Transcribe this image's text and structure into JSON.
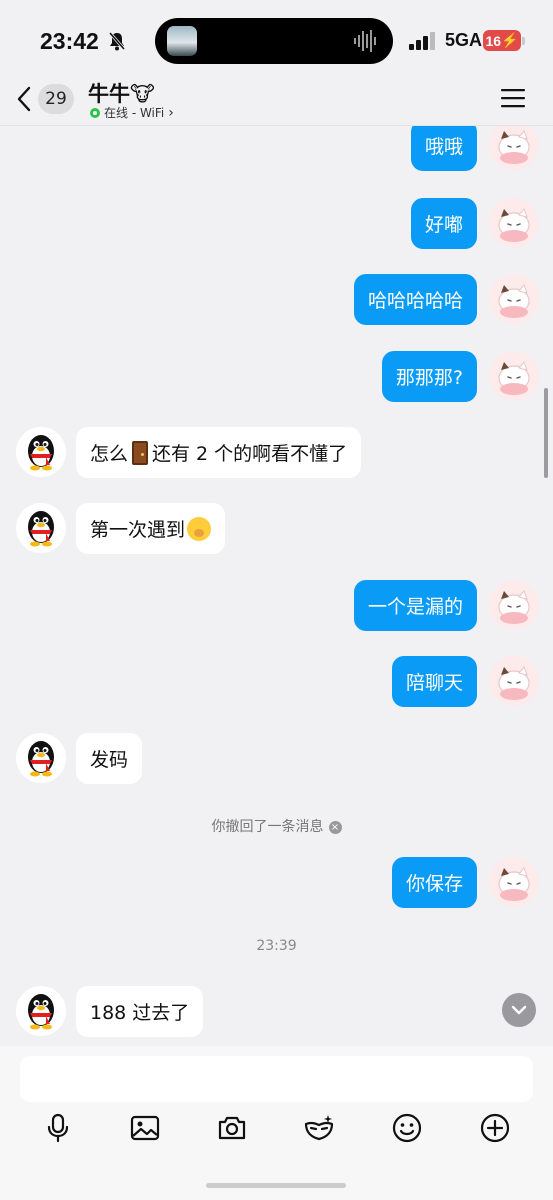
{
  "status_bar": {
    "time": "23:42",
    "network": "5GA",
    "battery": "16"
  },
  "header": {
    "back_count": "29",
    "contact_name": "牛牛🐮",
    "status_text": "在线 - WiFi",
    "status_chevron": "›"
  },
  "messages": [
    {
      "side": "out",
      "text": "哦哦"
    },
    {
      "side": "out",
      "text": "好嘟"
    },
    {
      "side": "out",
      "text": "哈哈哈哈哈"
    },
    {
      "side": "out",
      "text": "那那那?"
    },
    {
      "side": "in",
      "text_before": "怎么",
      "icon": "door-emoji",
      "text_after": "还有 2 个的啊看不懂了"
    },
    {
      "side": "in",
      "text": "第一次遇到",
      "icon": "yawning-face-emoji"
    },
    {
      "side": "out",
      "text": "一个是漏的"
    },
    {
      "side": "out",
      "text": "陪聊天"
    },
    {
      "side": "in",
      "text": "发码"
    },
    {
      "side": "out",
      "text": "你保存"
    },
    {
      "side": "in",
      "text": "188 过去了"
    }
  ],
  "system": {
    "recall_notice": "你撤回了一条消息",
    "recall_close": "×",
    "timestamp": "23:39"
  },
  "input": {
    "placeholder": ""
  },
  "toolbar_icons": [
    "microphone-icon",
    "image-icon",
    "camera-icon",
    "mask-icon",
    "emoji-icon",
    "plus-icon"
  ],
  "colors": {
    "outgoing_bubble": "#0a9bf7",
    "incoming_bubble": "#ffffff",
    "background": "#f1f1f3",
    "online": "#2bc34a",
    "battery_low": "#e24a4a"
  }
}
